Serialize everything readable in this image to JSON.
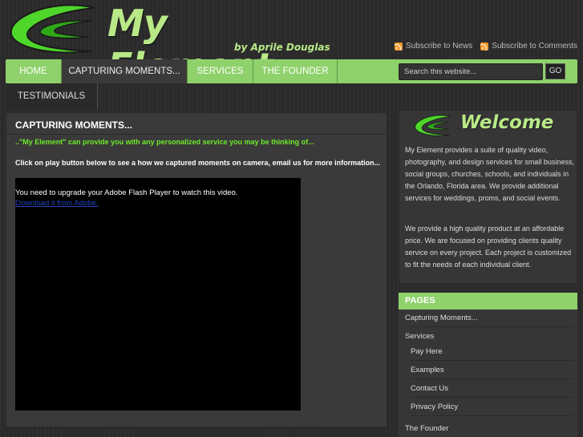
{
  "header": {
    "logo_title": "My Element",
    "logo_sub": "by Aprile Douglas",
    "subscribe_news": "Subscribe to News",
    "subscribe_comments": "Subscribe to Comments",
    "accent_color": "#8fd16b"
  },
  "nav": {
    "items": [
      {
        "label": "HOME"
      },
      {
        "label": "CAPTURING MOMENTS..."
      },
      {
        "label": "SERVICES"
      },
      {
        "label": "THE FOUNDER"
      },
      {
        "label": "TESTIMONIALS"
      }
    ],
    "search_placeholder": "Search this website...",
    "go_label": "GO"
  },
  "content": {
    "title": "CAPTURING MOMENTS...",
    "intro": "..\"My Element\" can provide you with any personalized service you may be thinking of...",
    "instruction": "Click on play button below to see a how we captured moments on camera, email us for more information...",
    "flash_message": "You need to upgrade your Adobe Flash Player to watch this video.",
    "flash_link": "Download it from Adobe."
  },
  "sidebar": {
    "welcome_title": "Welcome",
    "paragraph1": "My Element provides a suite of quality video, photography, and design services for small business, social groups, churches, schools, and individuals in the Orlando, Florida area. We provide additional services for weddings, proms, and social events.",
    "paragraph2": "We provide a high quality product at an affordable price. We are focused on providing clients quality service on every project. Each project is customized to fit the needs of each individual client.",
    "pages_heading": "PAGES",
    "pages": [
      {
        "label": "Capturing Moments..."
      },
      {
        "label": "Services"
      },
      {
        "label": "Pay Here"
      },
      {
        "label": "Examples"
      },
      {
        "label": "Contact Us"
      },
      {
        "label": "Privacy Policy"
      },
      {
        "label": "The Founder"
      }
    ]
  }
}
